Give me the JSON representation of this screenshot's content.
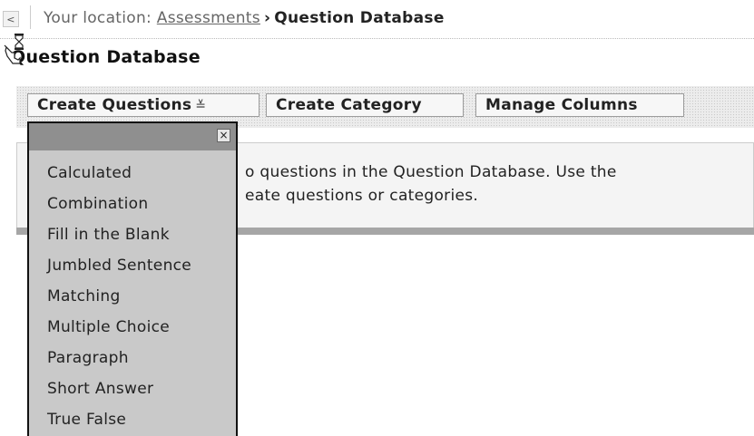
{
  "breadcrumb": {
    "back_label": "<",
    "location_label": "Your location:",
    "items": [
      "Assessments",
      "Question Database"
    ],
    "separator": "›"
  },
  "page": {
    "title": "Question Database"
  },
  "toolbar": {
    "create_questions_label": "Create Questions",
    "create_category_label": "Create Category",
    "manage_columns_label": "Manage Columns"
  },
  "message": {
    "line1": "o questions in the Question Database. Use the",
    "line2": "eate questions or categories."
  },
  "dropdown": {
    "close_label": "×",
    "items": [
      "Calculated",
      "Combination",
      "Fill in the Blank",
      "Jumbled Sentence",
      "Matching",
      "Multiple Choice",
      "Paragraph",
      "Short Answer",
      "True False"
    ]
  },
  "icons": {
    "cursor": "busy-hand-cursor-icon",
    "chevron": "chevron-down-icon",
    "back": "back-arrow-icon",
    "close": "close-icon"
  },
  "colors": {
    "dropdown_bg": "#c9c9c9",
    "dropdown_header": "#8f8f8f",
    "panel_bar": "#a6a6a6"
  }
}
